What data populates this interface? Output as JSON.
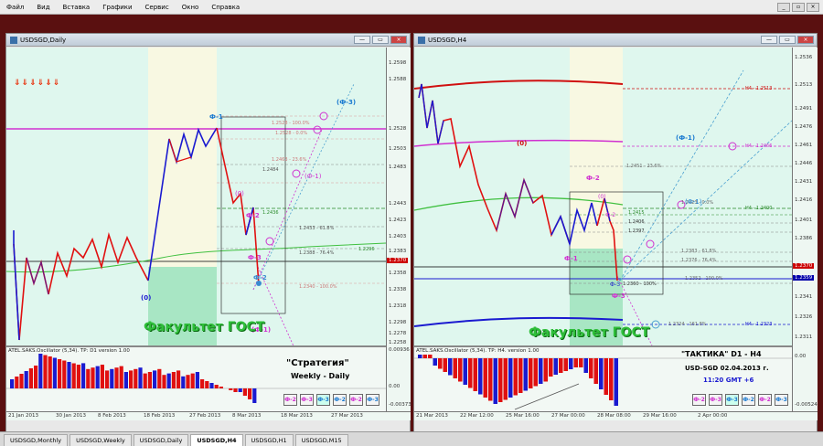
{
  "menu": {
    "items": [
      "Файл",
      "Вид",
      "Вставка",
      "Графики",
      "Сервис",
      "Окно",
      "Справка"
    ]
  },
  "left_window": {
    "title": "USDSGD,Daily",
    "price_labels": [
      "1.2598",
      "1.2588",
      "1.2528",
      "1.2503",
      "1.2483",
      "1.2443",
      "1.2423",
      "1.2403",
      "1.2383",
      "1.2370",
      "1.2358",
      "1.2338",
      "1.2318",
      "1.2298",
      "1.2278",
      "1.2258"
    ],
    "current_price": "1.2370",
    "level_labels": [
      "1.2528 - 100.0%",
      "1.2528 - 0.0%",
      "1.2484",
      "1.2463 - 23.6%",
      "1.2436",
      "1.2433 - 61.8%",
      "1.2388 - 76.4%",
      "1.2340 - 100.0%",
      "1.2296"
    ],
    "wave_labels": [
      "Ф-1",
      "(Ф-3)",
      "(0)",
      "Ф-2",
      "(Ф-1)",
      "Ф-3",
      "Ф-2",
      "(0)",
      "(Ф-1)"
    ],
    "dates": [
      "21 Jan 2013",
      "30 Jan 2013",
      "8 Feb 2013",
      "18 Feb 2013",
      "27 Feb 2013",
      "8 Mar 2013",
      "18 Mar 2013",
      "27 Mar 2013"
    ],
    "oscillator": {
      "label": "ATEL.SAKS.Oscillator (5,34). TP: D1 version 1.00",
      "scale": [
        "0.00936",
        "0.00",
        "-0.00373"
      ]
    },
    "watermark": "Факультет ГОСТ",
    "strategy_title": "\"Стратегия\"",
    "strategy_sub": "Weekly - Daily",
    "legend": [
      "Ф-2",
      "Ф-3",
      "Ф-3",
      "Ф-2",
      "Ф-2",
      "Ф-3"
    ],
    "arrow_count": 6
  },
  "right_window": {
    "title": "USDSGD,H4",
    "price_labels": [
      "1.2536",
      "1.2513",
      "1.2491",
      "1.2476",
      "1.2461",
      "1.2446",
      "1.2431",
      "1.2416",
      "1.2401",
      "1.2386",
      "1.2370",
      "1.2356",
      "1.2341",
      "1.2326",
      "1.2311"
    ],
    "current_price": "1.2370",
    "blue_price": "1.2359",
    "level_labels": [
      "H4 - 1.2513",
      "H4 - 1.2466",
      "1.2451 - 23.6%",
      "1.2423 - 0.0%",
      "H4 - 1.2400",
      "1.2415",
      "1.2406",
      "1.2397",
      "1.2383 - 61.8%",
      "1.2376 - 76.4%",
      "1.2352 - 100.0%",
      "1.2360 - 100%",
      "H4 - 1.2323",
      "1.2324 - 161.8%"
    ],
    "wave_labels": [
      "(0)",
      "(Ф-1)",
      "Ф-2",
      "(0)",
      "(Ф-1)",
      "Ф-2",
      "Ф-1",
      "Ф-3",
      "Ф-3"
    ],
    "dates": [
      "21 Mar 2013",
      "22 Mar 12:00",
      "25 Mar 16:00",
      "27 Mar 00:00",
      "28 Mar 08:00",
      "29 Mar 16:00",
      "2 Apr 00:00"
    ],
    "oscillator": {
      "label": "ATEL.SAKS.Oscillator (5,34). TP: H4. version 1.00",
      "scale": [
        "0.00",
        "-0.00524"
      ]
    },
    "watermark": "Факультет ГОСТ",
    "tactics_title": "\"ТАКТИКА\"    D1 - H4",
    "tactics_pair": "USD-SGD    02.04.2013 г.",
    "tactics_time": "11:20  GMT +6",
    "legend": [
      "Ф-2",
      "Ф-3",
      "Ф-3",
      "Ф-2",
      "Ф-2",
      "Ф-3"
    ]
  },
  "tabs": [
    "USDSGD,Monthly",
    "USDSGD,Weekly",
    "USDSGD,Daily",
    "USDSGD,H4",
    "USDSGD,H1",
    "USDSGD,M15"
  ],
  "active_tab": "USDSGD,H4",
  "colors": {
    "background": "#5a1010",
    "chart_bg": "#dff7ee",
    "watermark": "#2fbf3a",
    "wave_red": "#e01010",
    "wave_blue": "#1a1ad0",
    "magenta": "#d020d0",
    "sma_green": "#40c040"
  }
}
